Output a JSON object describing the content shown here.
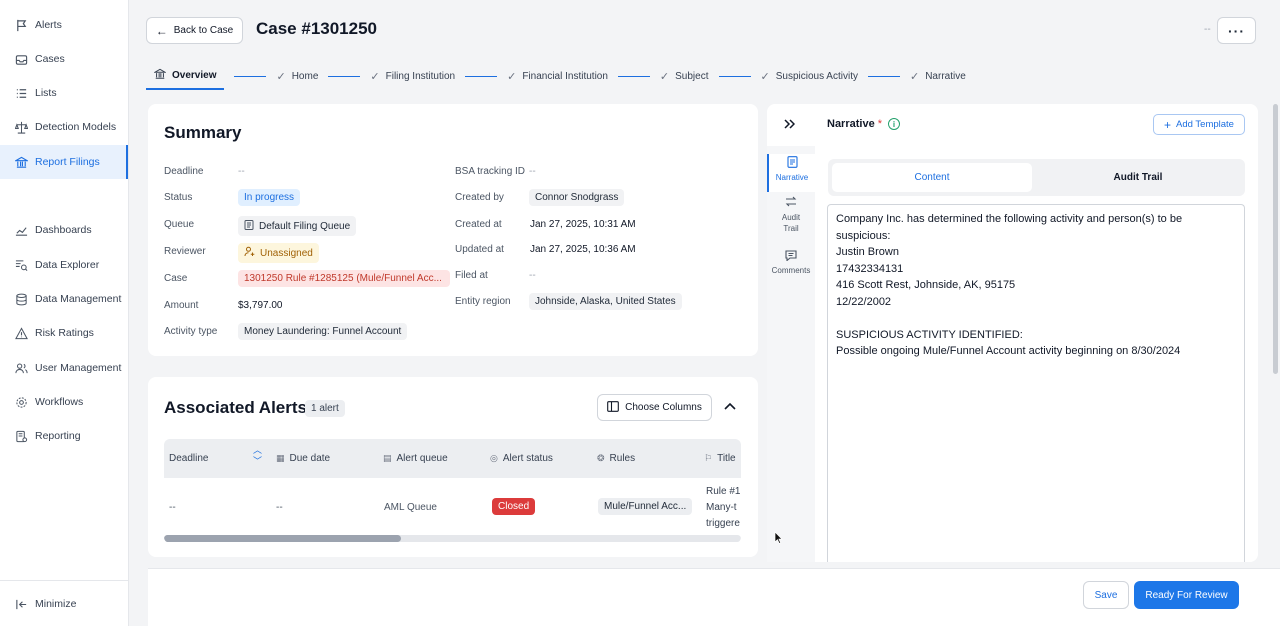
{
  "sidebar": {
    "items": [
      {
        "label": "Alerts",
        "icon": "flag-icon"
      },
      {
        "label": "Cases",
        "icon": "inbox-icon"
      },
      {
        "label": "Lists",
        "icon": "list-icon"
      },
      {
        "label": "Detection Models",
        "icon": "scale-icon"
      },
      {
        "label": "Report Filings",
        "icon": "bank-icon",
        "active": true
      },
      {
        "label": "Dashboards",
        "icon": "chart-line-icon"
      },
      {
        "label": "Data Explorer",
        "icon": "search-list-icon"
      },
      {
        "label": "Data Management",
        "icon": "database-icon"
      },
      {
        "label": "Risk Ratings",
        "icon": "warning-icon"
      },
      {
        "label": "User Management",
        "icon": "users-icon"
      },
      {
        "label": "Workflows",
        "icon": "gear-icon"
      },
      {
        "label": "Reporting",
        "icon": "report-icon"
      }
    ],
    "minimize_label": "Minimize"
  },
  "header": {
    "back_label": "Back to Case",
    "title": "Case #1301250",
    "dash": "--"
  },
  "stepper": {
    "steps": [
      "Overview",
      "Home",
      "Filing Institution",
      "Financial Institution",
      "Subject",
      "Suspicious Activity",
      "Narrative"
    ]
  },
  "summary": {
    "title": "Summary",
    "left": {
      "deadline_label": "Deadline",
      "deadline_value": "--",
      "status_label": "Status",
      "status_value": "In progress",
      "queue_label": "Queue",
      "queue_value": "Default Filing Queue",
      "reviewer_label": "Reviewer",
      "reviewer_value": "Unassigned",
      "case_label": "Case",
      "case_value": "1301250 Rule #1285125 (Mule/Funnel Acc...",
      "amount_label": "Amount",
      "amount_value": "$3,797.00",
      "activity_label": "Activity type",
      "activity_value": "Money Laundering: Funnel Account"
    },
    "right": {
      "bsa_label": "BSA tracking ID",
      "bsa_value": "--",
      "created_by_label": "Created by",
      "created_by_value": "Connor Snodgrass",
      "created_at_label": "Created at",
      "created_at_value": "Jan 27, 2025, 10:31 AM",
      "updated_at_label": "Updated at",
      "updated_at_value": "Jan 27, 2025, 10:36 AM",
      "filed_at_label": "Filed at",
      "filed_at_value": "--",
      "region_label": "Entity region",
      "region_value": "Johnside, Alaska, United States"
    }
  },
  "alerts": {
    "title": "Associated Alerts",
    "count": "1 alert",
    "choose_columns": "Choose Columns",
    "columns": [
      "Deadline",
      "Due date",
      "Alert queue",
      "Alert status",
      "Rules",
      "Title"
    ],
    "row": {
      "deadline": "--",
      "due_date": "--",
      "queue": "AML Queue",
      "status": "Closed",
      "rules": "Mule/Funnel Acc...",
      "title_line1": "Rule #1",
      "title_line2": "Many-t",
      "title_line3": "triggere"
    },
    "scroll_fraction": 0.41
  },
  "narrative": {
    "title": "Narrative",
    "required_mark": "*",
    "add_template": "Add Template",
    "side_tabs": [
      "Narrative",
      "Audit Trail",
      "Comments"
    ],
    "tabs": [
      "Content",
      "Audit Trail"
    ],
    "body": "Company Inc. has determined the following activity and person(s) to be suspicious:\nJustin Brown\n17432334131\n416 Scott Rest, Johnside, AK, 95175\n12/22/2002\n\nSUSPICIOUS ACTIVITY IDENTIFIED:\nPossible ongoing Mule/Funnel Account activity beginning on 8/30/2024"
  },
  "footer": {
    "save": "Save",
    "ready": "Ready For Review"
  },
  "colors": {
    "accent": "#1d6fe0",
    "danger": "#dc3b3b"
  }
}
